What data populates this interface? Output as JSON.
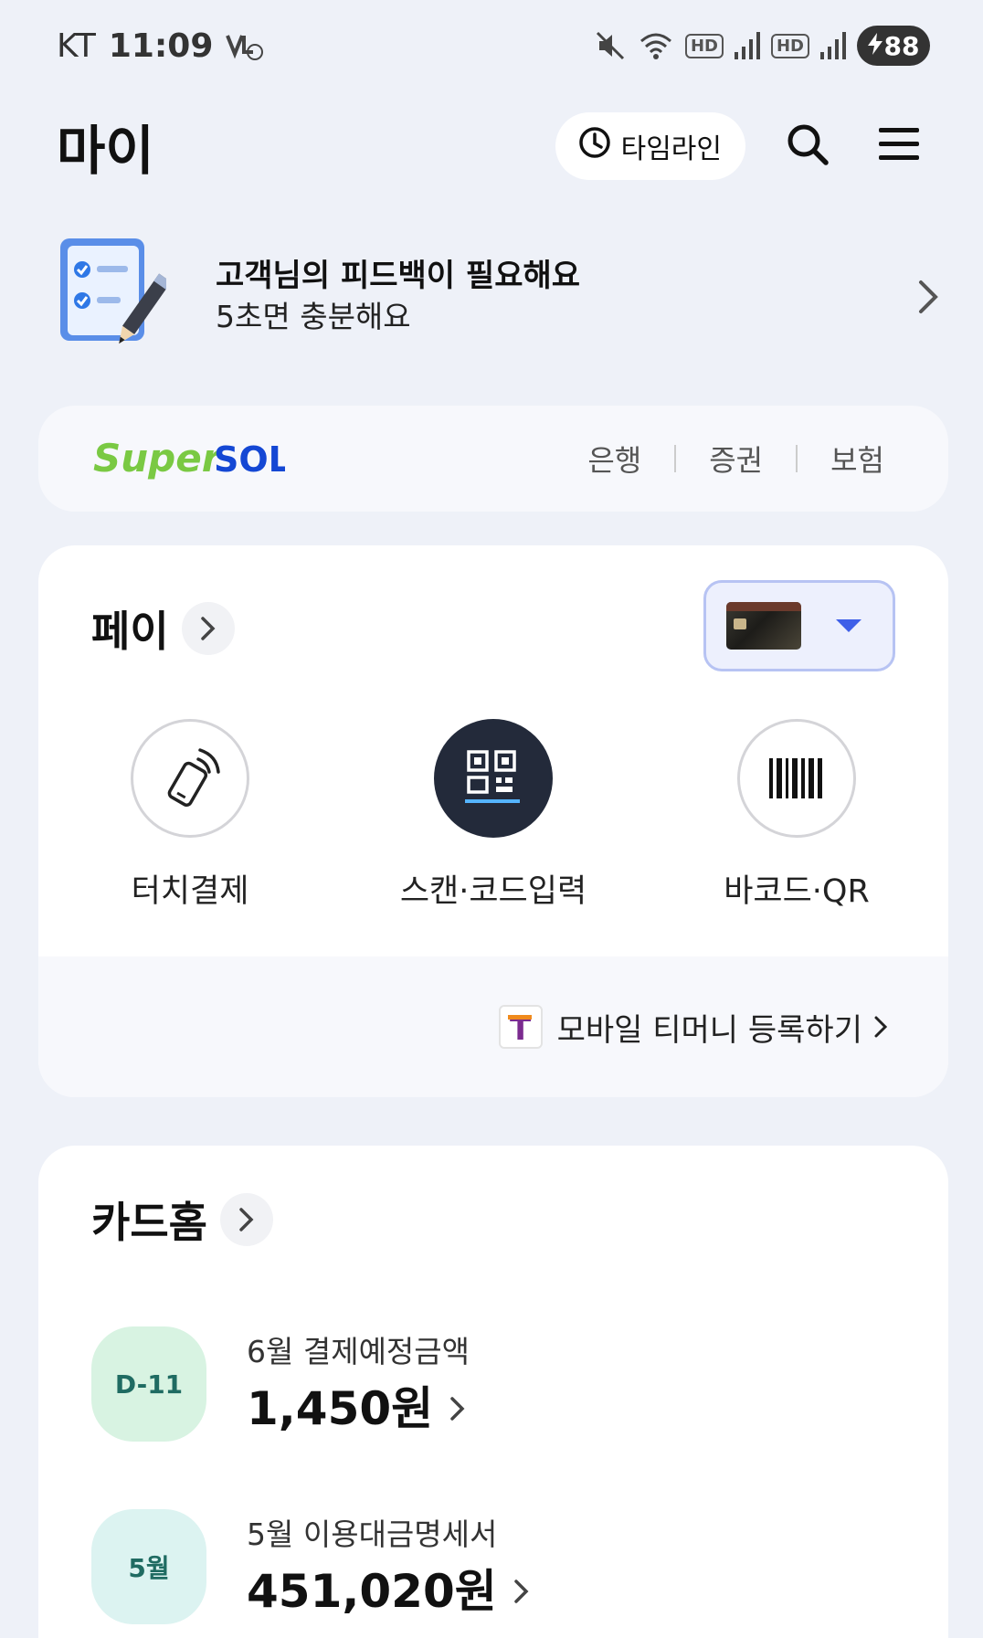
{
  "status_bar": {
    "carrier": "KT",
    "time": "11:09",
    "battery": "88",
    "hd_labels": [
      "HD",
      "HD"
    ]
  },
  "header": {
    "title": "마이",
    "timeline_label": "타임라인",
    "icons": [
      "clock-icon",
      "search-icon",
      "menu-icon"
    ]
  },
  "feedback": {
    "title": "고객님의 피드백이 필요해요",
    "subtitle": "5초면 충분해요"
  },
  "supersol": {
    "logo_super": "Super",
    "logo_sol": "SOL",
    "links": [
      "은행",
      "증권",
      "보험"
    ],
    "colors": {
      "super": "#7ac943",
      "sol": "#1447d4"
    }
  },
  "pay": {
    "title": "페이",
    "actions": [
      {
        "label": "터치결제",
        "icon": "touch-pay-icon"
      },
      {
        "label": "스캔·코드입력",
        "icon": "qr-scan-icon"
      },
      {
        "label": "바코드·QR",
        "icon": "barcode-icon"
      }
    ],
    "tmoney_label": "모바일 티머니 등록하기",
    "tmoney_logo_letter": "T"
  },
  "card_home": {
    "title": "카드홈",
    "bills": [
      {
        "badge": "D-11",
        "label": "6월 결제예정금액",
        "amount": "1,450원"
      },
      {
        "badge": "5월",
        "label": "5월 이용대금명세서",
        "amount": "451,020원"
      }
    ]
  }
}
